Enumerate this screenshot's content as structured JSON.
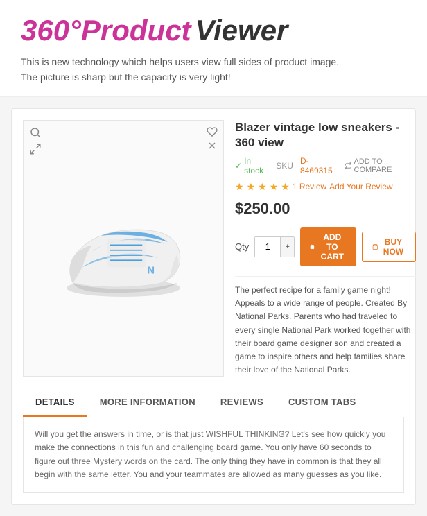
{
  "header": {
    "title_360": "360°",
    "title_product": "Product",
    "title_viewer": " Viewer",
    "subtitle_line1": "This is new technology which helps users view full sides of product image.",
    "subtitle_line2": "The picture is sharp but the capacity is very light!"
  },
  "product": {
    "name": "Blazer vintage low sneakers - 360 view",
    "in_stock": "In stock",
    "sku_label": "SKU",
    "sku_value": "D-8469315",
    "compare": "ADD TO COMPARE",
    "stars": 5,
    "review_count": "1 Review",
    "add_review": "Add Your Review",
    "price": "$250.00",
    "qty_label": "Qty",
    "qty_value": "1",
    "btn_cart": "ADD TO CART",
    "btn_buy": "BUY NOW",
    "description": "The perfect recipe for a family game night! Appeals to a wide range of people. Created By National Parks. Parents who had traveled to every single National Park worked together with their board game designer son and created a game to inspire others and help families share their love of the National Parks."
  },
  "tabs": [
    {
      "id": "details",
      "label": "DETAILS",
      "active": true
    },
    {
      "id": "more-info",
      "label": "MORE INFORMATION",
      "active": false
    },
    {
      "id": "reviews",
      "label": "REVIEWS",
      "active": false
    },
    {
      "id": "custom-tabs",
      "label": "CUSTOM TABS",
      "active": false
    }
  ],
  "tab_content": "Will you get the answers in time, or is that just WISHFUL THINKING? Let's see how quickly you make the connections in this fun and challenging board game. You only have 60 seconds to figure out three Mystery words on the card. The only thing they have in common is that they all begin with the same letter. You and your teammates are allowed as many guesses as you like."
}
